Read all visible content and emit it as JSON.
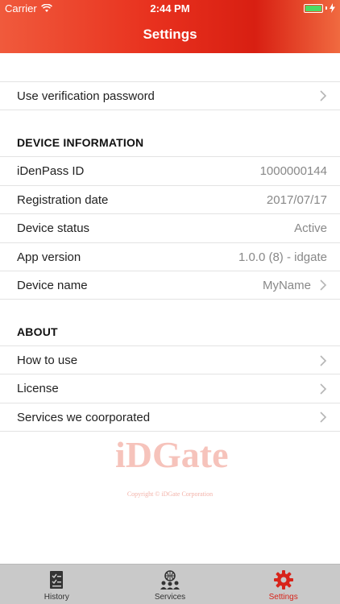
{
  "status_bar": {
    "carrier": "Carrier",
    "time": "2:44 PM",
    "battery_level": 1.0
  },
  "header": {
    "title": "Settings"
  },
  "security": {
    "verification_label": "Use verification password"
  },
  "device_info": {
    "section_title": "DEVICE INFORMATION",
    "rows": [
      {
        "label": "iDenPass ID",
        "value": "1000000144"
      },
      {
        "label": "Registration date",
        "value": "2017/07/17"
      },
      {
        "label": "Device status",
        "value": "Active"
      },
      {
        "label": "App version",
        "value": "1.0.0 (8) - idgate"
      },
      {
        "label": "Device name",
        "value": "MyName"
      }
    ]
  },
  "about": {
    "section_title": "ABOUT",
    "rows": [
      {
        "label": "How to use"
      },
      {
        "label": "License"
      },
      {
        "label": "Services we coorporated"
      }
    ]
  },
  "branding": {
    "logo_text": "iDGate",
    "copyright": "Copyright © iDGate Corporation"
  },
  "tabs": [
    {
      "label": "History",
      "icon": "history-icon"
    },
    {
      "label": "Services",
      "icon": "services-icon"
    },
    {
      "label": "Settings",
      "icon": "gear-icon"
    }
  ],
  "colors": {
    "accent": "#d8241a",
    "header_start": "#f05a3c",
    "header_end": "#d81f12"
  }
}
